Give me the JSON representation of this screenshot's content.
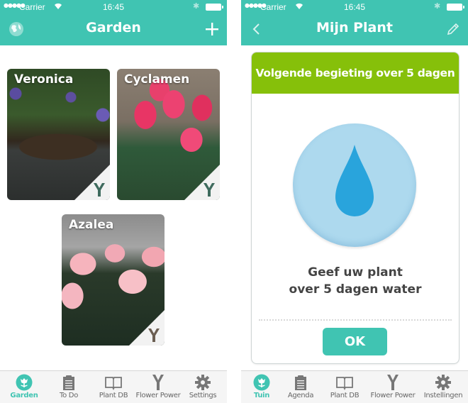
{
  "colors": {
    "brand_teal": "#40c4b2",
    "header_green": "#86c00a",
    "water_circle": "#add9ee",
    "water_drop": "#29a4dc",
    "text_dark": "#444444",
    "tab_inactive": "#666666"
  },
  "status_bar": {
    "signal": "●●●●●",
    "carrier": "Carrier",
    "time": "16:45",
    "bluetooth": "bluetooth-icon",
    "battery": "battery-full-icon"
  },
  "garden_screen": {
    "title": "Garden",
    "left_icon": "globe-icon",
    "right_icon": "plus-icon",
    "plants": [
      {
        "name": "Veronica",
        "badge_icon": "flower-power-sensor-icon",
        "badge_color": "#3f6b5e"
      },
      {
        "name": "Cyclamen",
        "badge_icon": "flower-power-sensor-icon",
        "badge_color": "#3f6b5e"
      },
      {
        "name": "Azalea",
        "badge_icon": "flower-power-sensor-icon",
        "badge_color": "#6b5e52"
      }
    ],
    "tabs": [
      {
        "label": "Garden",
        "icon": "garden-flower-icon",
        "active": true
      },
      {
        "label": "To Do",
        "icon": "clipboard-icon",
        "active": false
      },
      {
        "label": "Plant DB",
        "icon": "book-icon",
        "active": false
      },
      {
        "label": "Flower Power",
        "icon": "flower-power-sensor-icon",
        "active": false
      },
      {
        "label": "Settings",
        "icon": "gear-icon",
        "active": false
      }
    ]
  },
  "plant_screen": {
    "title": "Mijn Plant",
    "left_icon": "back-chevron-icon",
    "right_icon": "pencil-icon",
    "card": {
      "header": "Volgende begieting over 5 dagen",
      "icon": "water-drop-icon",
      "message_line1": "Geef uw plant",
      "message_line2": "over 5 dagen water",
      "ok_label": "OK"
    },
    "tabs": [
      {
        "label": "Tuin",
        "icon": "garden-flower-icon",
        "active": true
      },
      {
        "label": "Agenda",
        "icon": "clipboard-icon",
        "active": false
      },
      {
        "label": "Plant DB",
        "icon": "book-icon",
        "active": false
      },
      {
        "label": "Flower Power",
        "icon": "flower-power-sensor-icon",
        "active": false
      },
      {
        "label": "Instellingen",
        "icon": "gear-icon",
        "active": false
      }
    ]
  }
}
